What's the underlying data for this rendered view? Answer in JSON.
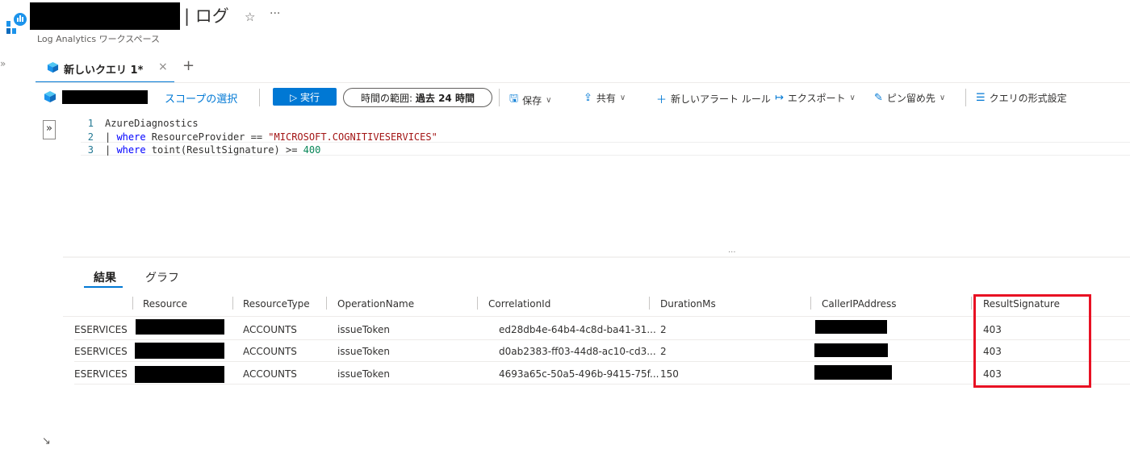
{
  "header": {
    "title_suffix": "| ログ",
    "subtitle": "Log Analytics ワークスペース",
    "star_icon": "star-icon",
    "more_label": "···",
    "sidebar_expand_label": "»"
  },
  "tabs": {
    "active_label": "新しいクエリ 1*",
    "close_label": "×",
    "add_label": "+"
  },
  "toolbar": {
    "scope_label": "スコープの選択",
    "run_label": "▷ 実行",
    "time_range_prefix": "時間の範囲: ",
    "time_range_value": "過去 24 時間",
    "save_label": "保存",
    "share_label": "共有",
    "new_alert_label": "新しいアラート ルール",
    "export_label": "エクスポート",
    "pin_label": "ピン留め先",
    "format_label": "クエリの形式設定"
  },
  "editor": {
    "collapse_label": "»",
    "lines": [
      {
        "num": "1",
        "text": "AzureDiagnostics"
      },
      {
        "num": "2",
        "pipe": "| ",
        "kw": "where",
        "text": " ResourceProvider == ",
        "str": "\"MICROSOFT.COGNITIVESERVICES\""
      },
      {
        "num": "3",
        "pipe": "| ",
        "kw": "where",
        "text": " toint(ResultSignature) >= ",
        "num_val": "400"
      }
    ]
  },
  "results": {
    "tab_results": "結果",
    "tab_graph": "グラフ",
    "columns": [
      "Resource",
      "ResourceType",
      "OperationName",
      "CorrelationId",
      "DurationMs",
      "CallerIPAddress",
      "ResultSignature"
    ],
    "rows": [
      {
        "provider": "ESERVICES",
        "resource_type": "ACCOUNTS",
        "operation": "issueToken",
        "correlation": "ed28db4e-64b4-4c8d-ba41-31...",
        "duration": "2",
        "result": "403"
      },
      {
        "provider": "ESERVICES",
        "resource_type": "ACCOUNTS",
        "operation": "issueToken",
        "correlation": "d0ab2383-ff03-44d8-ac10-cd3...",
        "duration": "2",
        "result": "403"
      },
      {
        "provider": "ESERVICES",
        "resource_type": "ACCOUNTS",
        "operation": "issueToken",
        "correlation": "4693a65c-50a5-496b-9415-75f...",
        "duration": "150",
        "result": "403"
      }
    ]
  },
  "colors": {
    "accent": "#0078d4",
    "highlight": "#e81123"
  }
}
